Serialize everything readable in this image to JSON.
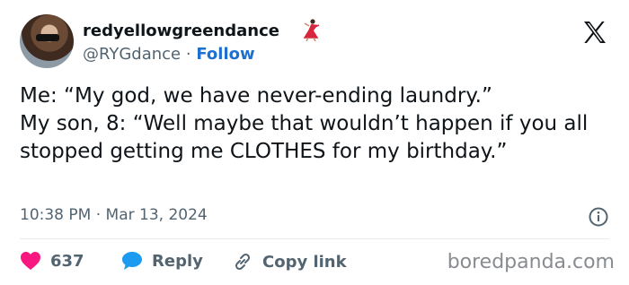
{
  "header": {
    "display_name": "redyellowgreendance",
    "handle": "@RYGdance",
    "separator": "·",
    "follow_label": "Follow"
  },
  "tweet": {
    "text": "Me: “My god, we have never-ending laundry.”\nMy son, 8: “Well maybe that wouldn’t happen if you all stopped getting me CLOTHES for my birthday.”",
    "timestamp": "10:38 PM · Mar 13, 2024"
  },
  "actions": {
    "like_count": "637",
    "reply_label": "Reply",
    "copy_label": "Copy link"
  },
  "watermark": "boredpanda.com",
  "colors": {
    "like": "#f91880",
    "reply": "#1d9bf0",
    "follow": "#1d6fd1",
    "muted": "#536471"
  },
  "icons": [
    "avatar",
    "dancer-emoji-icon",
    "x-logo-icon",
    "info-icon",
    "heart-icon",
    "reply-bubble-icon",
    "link-icon"
  ]
}
